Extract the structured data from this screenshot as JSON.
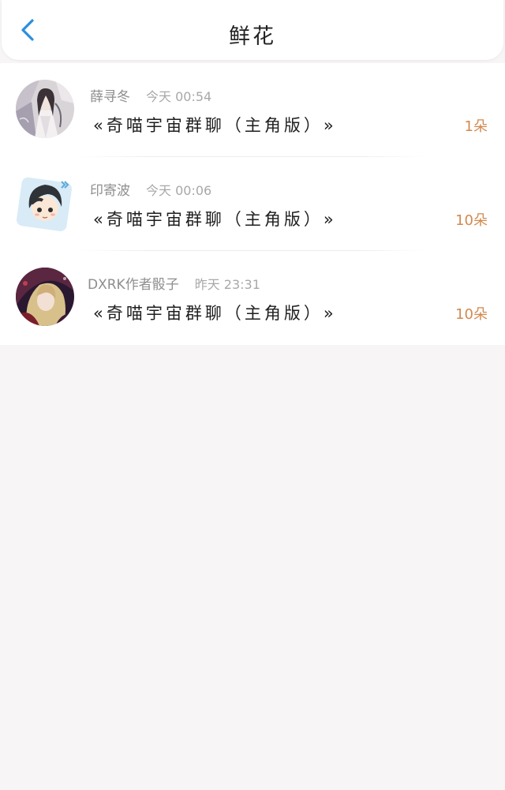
{
  "header": {
    "title": "鲜花"
  },
  "records": [
    {
      "user": "薛寻冬",
      "time": "今天 00:54",
      "book": "«奇喵宇宙群聊（主角版）»",
      "amount": "1朵"
    },
    {
      "user": "印寄波",
      "time": "今天 00:06",
      "book": "«奇喵宇宙群聊（主角版）»",
      "amount": "10朵"
    },
    {
      "user": "DXRK作者骰子",
      "time": "昨天 23:31",
      "book": "«奇喵宇宙群聊（主角版）»",
      "amount": "10朵"
    }
  ],
  "colors": {
    "accent": "#2a8fe0",
    "amount": "#d18a50",
    "background": "#f7f5f6"
  },
  "icons": {
    "back": "chevron-left-icon"
  }
}
